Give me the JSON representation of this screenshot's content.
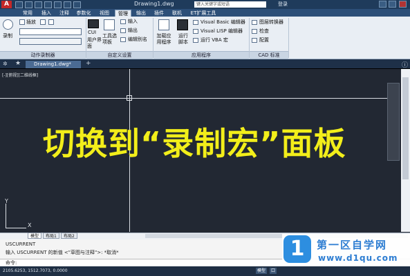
{
  "titlebar": {
    "document": "Drawing1.dwg",
    "search_placeholder": "键入关键字或短语",
    "user": "登录"
  },
  "tabs": [
    "常用",
    "插入",
    "注释",
    "参数化",
    "视图",
    "管理",
    "输出",
    "插件",
    "联机",
    "ET扩展工具"
  ],
  "active_tab": "管理",
  "ribbon": {
    "record_label": "录制",
    "insert_label": "插放",
    "panels": {
      "action_recorder": "动作录制器",
      "customization": "自定义设置",
      "applications": "应用程序",
      "cad_standards": "CAD 标准"
    },
    "customization_buttons": [
      "CUI",
      "用户界面",
      "工具选项板",
      "输入",
      "输出",
      "编辑别名"
    ],
    "app_buttons": [
      "加载应用程序",
      "运行脚本"
    ],
    "app_items": [
      "Visual Basic 编辑器",
      "Visual LISP 编辑器",
      "运行 VBA 宏"
    ],
    "std_items": [
      "图层转换器",
      "检查",
      "配置"
    ]
  },
  "filetab": "Drawing1.dwg*",
  "viewport_label": "[-][俯视][二维线框]",
  "overlay_text": "切换到“录制宏”面板",
  "ucs": {
    "x": "X",
    "y": "Y"
  },
  "layouts": [
    "模型",
    "布局1",
    "布局2"
  ],
  "command": {
    "line1": "USCURRENT",
    "line2": "输入 USCURRENT 的新值 <\"草图与注释\">: *取消*",
    "prompt": "命令:"
  },
  "status": {
    "coords": "2105.6253, 1512.7073, 0.0000",
    "buttons": [
      "模型",
      "口",
      "1:1",
      "人"
    ]
  },
  "watermark": {
    "title": "第一区自学网",
    "url": "www.d1qu.com"
  }
}
